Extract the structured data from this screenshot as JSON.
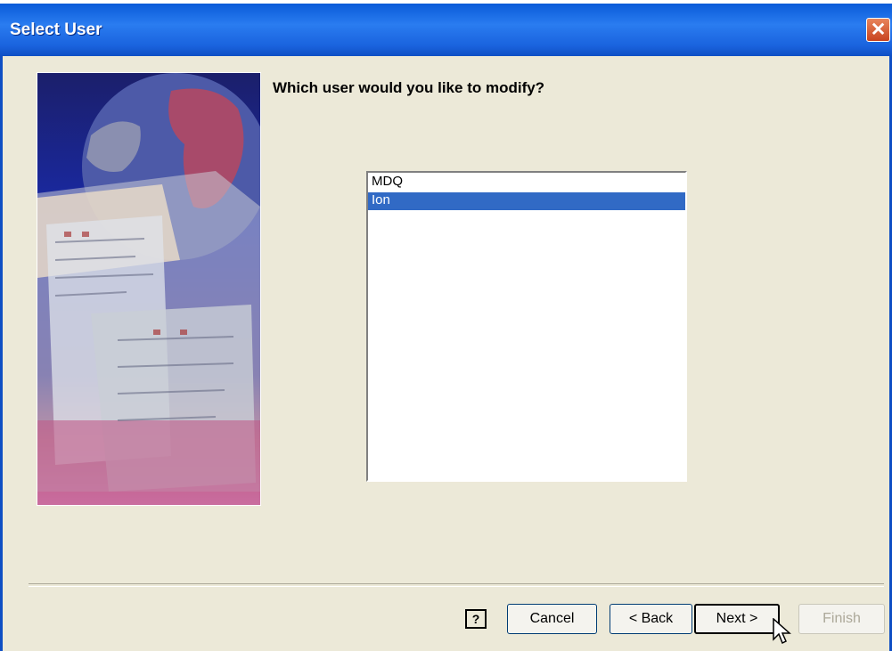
{
  "window": {
    "title": "Select User",
    "close_label": "✕"
  },
  "prompt": "Which user would you like to modify?",
  "users": [
    {
      "name": "MDQ",
      "selected": false
    },
    {
      "name": "Ion",
      "selected": true
    }
  ],
  "buttons": {
    "help": "?",
    "cancel": "Cancel",
    "back": "< Back",
    "next": "Next >",
    "finish": "Finish"
  },
  "colors": {
    "titlebar": "#0a5bd8",
    "selection": "#316ac5",
    "dialog_bg": "#ece9d8"
  }
}
